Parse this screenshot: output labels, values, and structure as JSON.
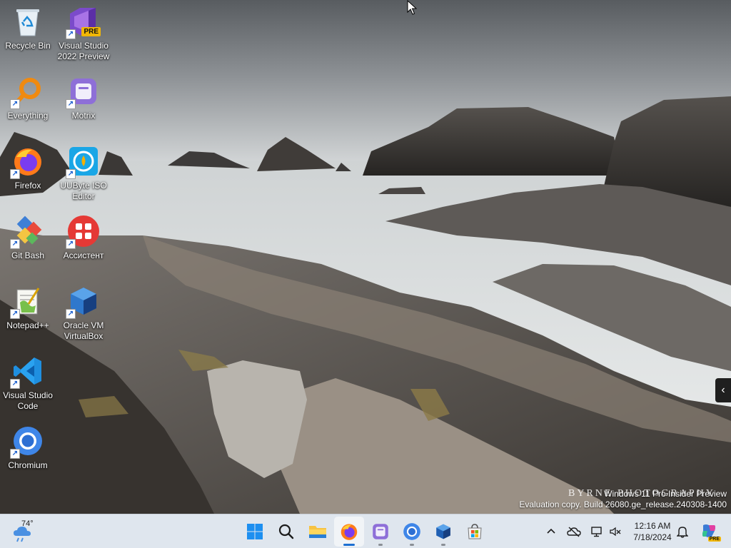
{
  "desktop": {
    "icons": [
      {
        "label": "Recycle Bin",
        "icon": "recycle-bin-icon"
      },
      {
        "label": "Visual Studio 2022 Preview",
        "icon": "visual-studio-icon",
        "badge": "PRE"
      },
      {
        "label": "Everything",
        "icon": "everything-search-icon"
      },
      {
        "label": "Motrix",
        "icon": "motrix-icon"
      },
      {
        "label": "Firefox",
        "icon": "firefox-icon"
      },
      {
        "label": "UUByte ISO Editor",
        "icon": "uubyte-iso-editor-icon"
      },
      {
        "label": "Git Bash",
        "icon": "git-bash-icon"
      },
      {
        "label": "Ассистент",
        "icon": "assistant-icon"
      },
      {
        "label": "Notepad++",
        "icon": "notepad-plus-plus-icon"
      },
      {
        "label": "Oracle VM VirtualBox",
        "icon": "virtualbox-icon"
      },
      {
        "label": "Visual Studio Code",
        "icon": "vscode-icon"
      },
      {
        "label": "Chromium",
        "icon": "chromium-icon"
      }
    ],
    "watermark": {
      "line1": "Windows 11 Pro Insider Preview",
      "line2": "Evaluation copy. Build 26080.ge_release.240308-1400"
    },
    "photographer": "BYRNE PHOTOGRAPHY"
  },
  "taskbar": {
    "weather": {
      "temp": "74°",
      "icon": "weather-cloud-rain-icon"
    },
    "apps": [
      {
        "name": "Start",
        "icon": "windows-start-icon",
        "state": "none"
      },
      {
        "name": "Search",
        "icon": "search-icon",
        "state": "none"
      },
      {
        "name": "File Explorer",
        "icon": "file-explorer-icon",
        "state": "none"
      },
      {
        "name": "Firefox",
        "icon": "firefox-icon",
        "state": "active"
      },
      {
        "name": "Motrix",
        "icon": "motrix-icon",
        "state": "running"
      },
      {
        "name": "Chromium",
        "icon": "chromium-icon",
        "state": "running"
      },
      {
        "name": "Oracle VM VirtualBox",
        "icon": "virtualbox-icon",
        "state": "running"
      },
      {
        "name": "Microsoft Store",
        "icon": "microsoft-store-icon",
        "state": "none"
      }
    ],
    "tray": {
      "icons": [
        "chevron-up-icon",
        "onedrive-offline-icon",
        "network-icon",
        "volume-muted-icon",
        "notifications-bell-icon",
        "copilot-icon"
      ],
      "time": "12:16 AM",
      "date": "7/18/2024",
      "copilot_badge": "PRE"
    }
  },
  "colors": {
    "taskbar_bg": "#dfe6ee",
    "accent": "#1d6fd1"
  }
}
